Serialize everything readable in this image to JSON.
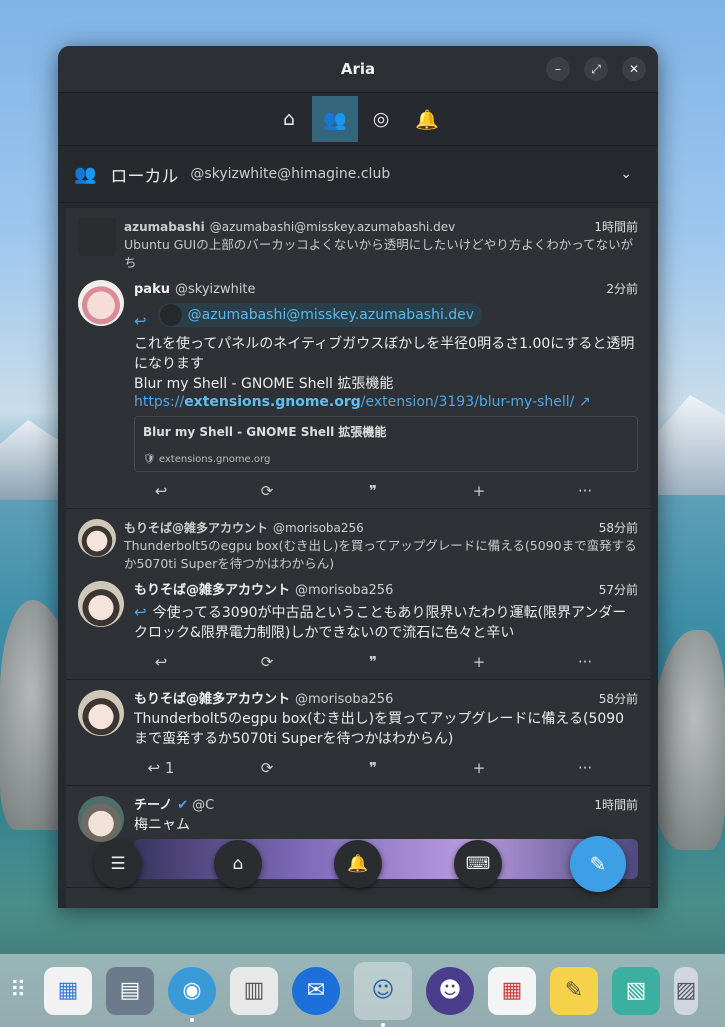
{
  "window": {
    "title": "Aria",
    "controls": {
      "minimize": "–",
      "maximize": "⤢",
      "close": "✕"
    }
  },
  "nav_tabs": [
    {
      "icon": "home-icon",
      "glyph": "⌂",
      "active": false
    },
    {
      "icon": "local-timeline-icon",
      "glyph": "👥",
      "active": true
    },
    {
      "icon": "global-timeline-icon",
      "glyph": "◎",
      "active": false
    },
    {
      "icon": "notifications-icon",
      "glyph": "🔔",
      "active": false
    }
  ],
  "timeline": {
    "name": "ローカル",
    "account": "@skyizwhite@himagine.club"
  },
  "posts": [
    {
      "reply_to": {
        "name": "azumabashi",
        "user": "@azumabashi@misskey.azumabashi.dev",
        "time": "1時間前",
        "text": "Ubuntu GUIの上部のバーカッコよくないから透明にしたいけどやり方よくわかってないがち"
      },
      "name": "paku",
      "user": "@skyizwhite",
      "time": "2分前",
      "mention": "@azumabashi@misskey.azumabashi.dev",
      "text1": "これを使ってパネルのネイティブガウスぼかしを半径0明るさ1.00にすると透明になります",
      "text2": "Blur my Shell - GNOME Shell 拡張機能",
      "link_prefix": "https://",
      "link_domain": "extensions.gnome.org",
      "link_path": "/extension/3193/blur-my-shell/",
      "preview_title": "Blur my Shell - GNOME Shell 拡張機能",
      "preview_site": "extensions.gnome.org"
    },
    {
      "reply_to": {
        "name": "もりそば@雑多アカウント",
        "user": "@morisoba256",
        "time": "58分前",
        "text": "Thunderbolt5のegpu box(むき出し)を買ってアップグレードに備える(5090まで蛮発するか5070ti Superを待つかはわからん)"
      },
      "name": "もりそば@雑多アカウント",
      "user": "@morisoba256",
      "time": "57分前",
      "text": "今使ってる3090が中古品ということもあり限界いたわり運転(限界アンダークロック&限界電力制限)しかできないので流石に色々と辛い"
    },
    {
      "name": "もりそば@雑多アカウント",
      "user": "@morisoba256",
      "time": "58分前",
      "text": "Thunderbolt5のegpu box(むき出し)を買ってアップグレードに備える(5090まで蛮発するか5070ti Superを待つかはわからん)",
      "reply_count": "1"
    },
    {
      "name": "チーノ",
      "user": "@C",
      "time": "1時間前",
      "text": "梅ニャム"
    }
  ],
  "actions": {
    "reply": "↩",
    "renote": "⟳",
    "quote": "❞",
    "react": "+",
    "more": "···"
  },
  "float_bar": {
    "menu": "☰",
    "home": "⌂",
    "notifications": "🔔",
    "keyboard": "⌨"
  },
  "compose_button": "✎",
  "colors": {
    "accent": "#3da0e6",
    "active_tab": "#34657a",
    "window_bg": "#262a2e"
  },
  "dock": [
    {
      "icon": "app-grid-icon",
      "glyph": "⠿"
    },
    {
      "icon": "software-store-icon",
      "glyph": "▦"
    },
    {
      "icon": "file-manager-icon",
      "glyph": "▤"
    },
    {
      "icon": "aria-app-icon",
      "glyph": "◉",
      "running": true
    },
    {
      "icon": "news-reader-icon",
      "glyph": "▥"
    },
    {
      "icon": "thunderbird-icon",
      "glyph": "✉"
    },
    {
      "icon": "misskey-client-icon",
      "glyph": "☺",
      "active": true
    },
    {
      "icon": "cat-app-icon",
      "glyph": "☻"
    },
    {
      "icon": "calendar-icon",
      "glyph": "▦"
    },
    {
      "icon": "notes-icon",
      "glyph": "✎"
    },
    {
      "icon": "book-icon",
      "glyph": "▧"
    },
    {
      "icon": "settings-icon",
      "glyph": "▨"
    }
  ]
}
